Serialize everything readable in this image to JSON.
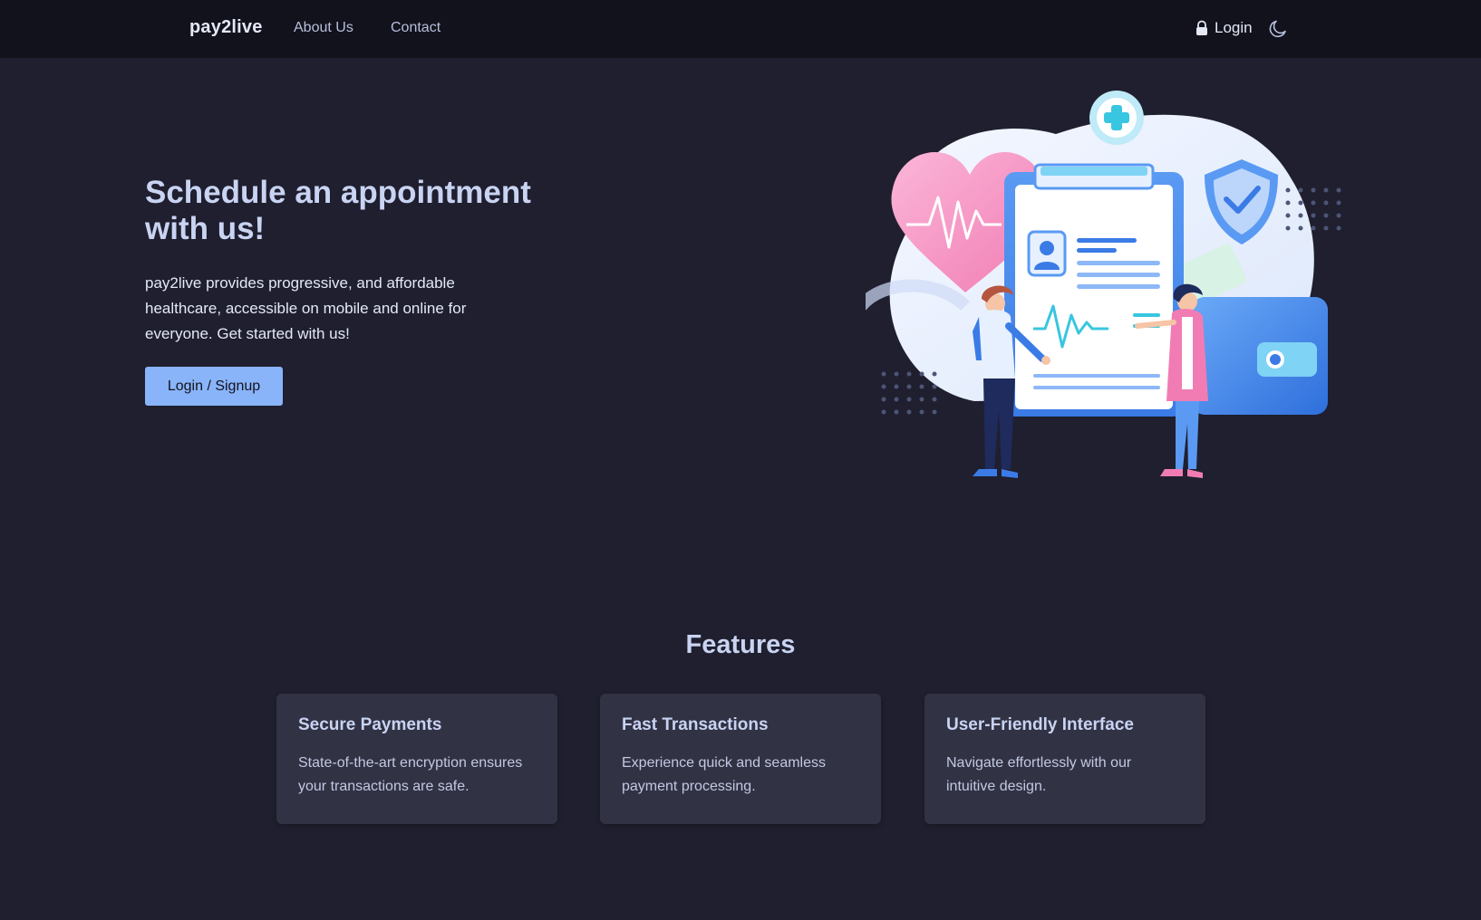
{
  "nav": {
    "brand": "pay2live",
    "links": [
      {
        "label": "About Us"
      },
      {
        "label": "Contact"
      }
    ],
    "login_label": "Login",
    "lock_icon": "lock-icon",
    "theme_icon": "moon-icon"
  },
  "hero": {
    "title": "Schedule an appointment with us!",
    "description": "pay2live provides progressive, and affordable healthcare, accessible on mobile and online for everyone. Get started with us!",
    "button_label": "Login / Signup",
    "illustration": "healthcare-clipboard-illustration"
  },
  "features": {
    "title": "Features",
    "cards": [
      {
        "title": "Secure Payments",
        "text": "State-of-the-art encryption ensures your transactions are safe."
      },
      {
        "title": "Fast Transactions",
        "text": "Experience quick and seamless payment processing."
      },
      {
        "title": "User-Friendly Interface",
        "text": "Navigate effortlessly with our intuitive design."
      }
    ]
  },
  "colors": {
    "background": "#1f1f2f",
    "navbar": "#12121c",
    "accent": "#89b4fa",
    "card": "#313244"
  }
}
